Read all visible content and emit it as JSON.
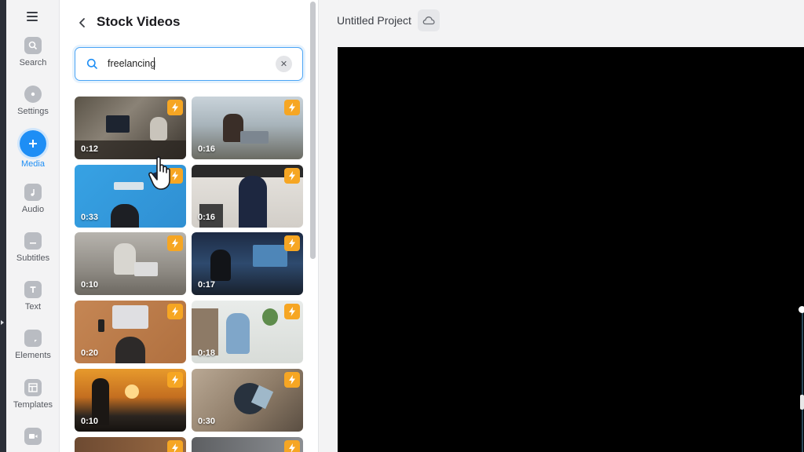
{
  "rail": {
    "items": [
      {
        "label": "Search",
        "icon": "search-icon"
      },
      {
        "label": "Settings",
        "icon": "gear-icon"
      },
      {
        "label": "Media",
        "icon": "plus-icon",
        "active": true
      },
      {
        "label": "Audio",
        "icon": "music-note-icon"
      },
      {
        "label": "Subtitles",
        "icon": "subtitles-icon"
      },
      {
        "label": "Text",
        "icon": "text-icon"
      },
      {
        "label": "Elements",
        "icon": "elements-icon"
      },
      {
        "label": "Templates",
        "icon": "templates-icon"
      }
    ]
  },
  "panel": {
    "title": "Stock Videos",
    "search_value": "freelancing"
  },
  "videos": [
    {
      "duration": "0:12"
    },
    {
      "duration": "0:16"
    },
    {
      "duration": "0:33"
    },
    {
      "duration": "0:16"
    },
    {
      "duration": "0:10"
    },
    {
      "duration": "0:17"
    },
    {
      "duration": "0:20"
    },
    {
      "duration": "0:18"
    },
    {
      "duration": "0:10"
    },
    {
      "duration": "0:30"
    }
  ],
  "topbar": {
    "project_name": "Untitled Project"
  },
  "colors": {
    "accent": "#1e8ef5",
    "badge": "#f6a623",
    "canvas": "#000000"
  }
}
